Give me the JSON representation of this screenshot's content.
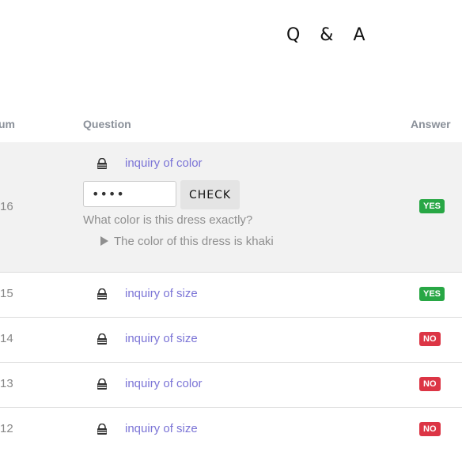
{
  "header": {
    "title": "Q & A"
  },
  "table": {
    "columns": {
      "num": "um",
      "question": "Question",
      "answer": "Answer"
    },
    "rows": [
      {
        "num": "16",
        "title": "inquiry of color",
        "answer": "YES",
        "answer_color": "#28a745",
        "expanded": {
          "password_value": "••••",
          "check_label": "CHECK",
          "question": "What color is this dress exactly?",
          "reply": "The color of this dress is khaki"
        }
      },
      {
        "num": "15",
        "title": "inquiry of size",
        "answer": "YES",
        "answer_color": "#28a745"
      },
      {
        "num": "14",
        "title": "inquiry of size",
        "answer": "NO",
        "answer_color": "#dc3545"
      },
      {
        "num": "13",
        "title": "inquiry of color",
        "answer": "NO",
        "answer_color": "#dc3545"
      },
      {
        "num": "12",
        "title": "inquiry of size",
        "answer": "NO",
        "answer_color": "#dc3545"
      }
    ]
  },
  "icons": {
    "lock": "lock-icon",
    "expand": "caret-right-icon"
  },
  "colors": {
    "link": "#7b74d6",
    "expanded_bg": "#f2f2f2"
  }
}
